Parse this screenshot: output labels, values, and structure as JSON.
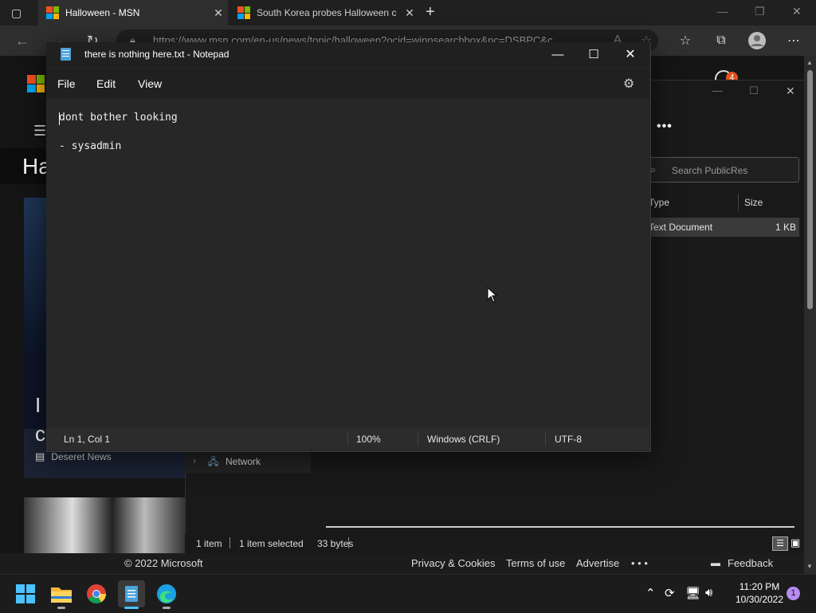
{
  "browser": {
    "tabs": [
      {
        "title": "Halloween - MSN",
        "active": true
      },
      {
        "title": "South Korea probes Halloween c",
        "active": false
      }
    ],
    "new_tab": "+",
    "url": "https://www.msn.com/en-us/news/topic/halloween?ocid=winpsearchbox&pc=DSBPC&c",
    "window_min": "—",
    "window_restore": "❐",
    "window_close": "✕"
  },
  "msn": {
    "heading": "Ha",
    "card_title_line1": "I",
    "card_title_line2": "c",
    "card_source": "Deseret News",
    "footer": {
      "copyright": "© 2022 Microsoft",
      "privacy": "Privacy & Cookies",
      "terms": "Terms of use",
      "advertise": "Advertise",
      "more": "• • •",
      "feedback": "Feedback"
    },
    "notification_count": "4"
  },
  "explorer": {
    "more": "•••",
    "search_placeholder": "Search PublicRes",
    "columns": {
      "type": "Type",
      "size": "Size"
    },
    "row": {
      "type": "Text Document",
      "size": "1 KB"
    },
    "nav_item": "Network",
    "status": {
      "items": "1 item",
      "selected": "1 item selected",
      "bytes": "33 bytes"
    }
  },
  "notepad": {
    "title": "there is nothing here.txt - Notepad",
    "menu": {
      "file": "File",
      "edit": "Edit",
      "view": "View"
    },
    "content": "dont bother looking\n\n- sysadmin",
    "status": {
      "position": "Ln 1, Col 1",
      "zoom": "100%",
      "line_ending": "Windows (CRLF)",
      "encoding": "UTF-8"
    }
  },
  "taskbar": {
    "time": "11:20 PM",
    "date": "10/30/2022",
    "notification_count": "1"
  },
  "colors": {
    "ms_red": "#f25022",
    "ms_green": "#7fba00",
    "ms_blue": "#00a4ef",
    "ms_yellow": "#ffb900",
    "accent": "#0078d4"
  }
}
